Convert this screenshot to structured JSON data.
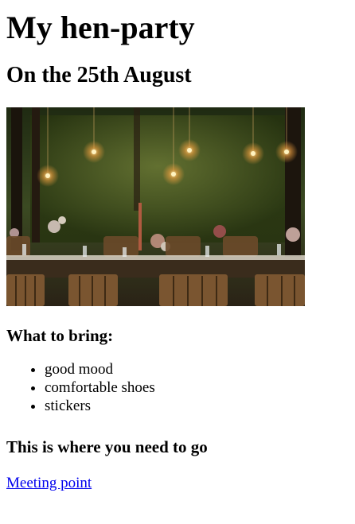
{
  "title": "My hen-party",
  "date": "On the 25th August",
  "image": {
    "alt": "Decorated outdoor dinner table under hanging lights in a forest"
  },
  "bring": {
    "heading": "What to bring:",
    "items": [
      "good mood",
      "comfortable shoes",
      "stickers"
    ]
  },
  "where": {
    "heading": "This is where you need to go",
    "link_label": "Meeting point"
  },
  "colors": {
    "link": "#0000ee",
    "text": "#000000",
    "background": "#ffffff"
  }
}
